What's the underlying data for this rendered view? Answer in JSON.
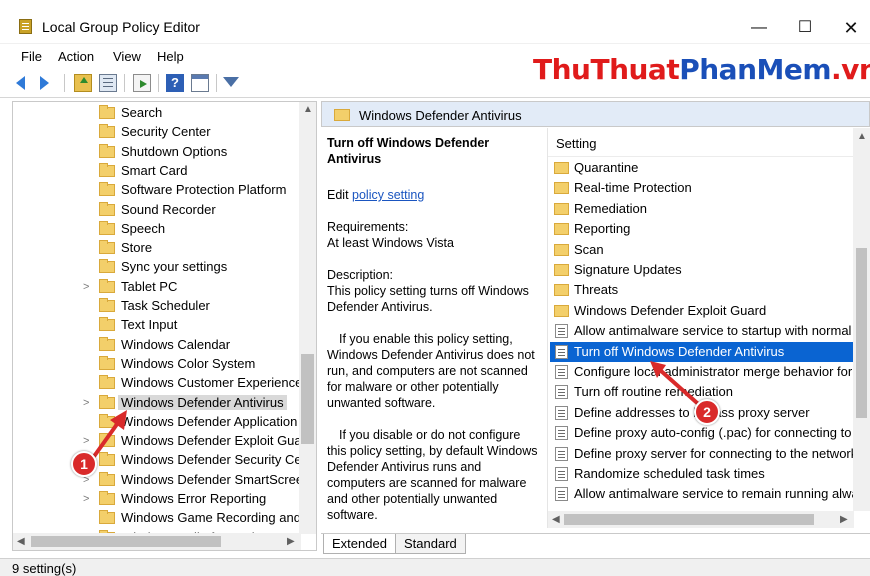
{
  "window": {
    "title": "Local Group Policy Editor",
    "minimize_glyph": "—",
    "maximize_glyph": "☐",
    "close_glyph": "✕"
  },
  "menu": [
    "File",
    "Action",
    "View",
    "Help"
  ],
  "toolbar": {
    "icons": [
      "back-icon",
      "forward-icon",
      "up-folder-icon",
      "show-hide-tree-icon",
      "export-list-icon",
      "help-icon",
      "properties-icon",
      "filter-icon"
    ],
    "help_glyph": "?"
  },
  "watermark": {
    "part1": "ThuThuat",
    "part2": "PhanMem",
    "part3": ".vn",
    "color1": "#e01b1b",
    "color2": "#1a4fb8"
  },
  "tree": {
    "items": [
      {
        "label": "Search",
        "expandable": false
      },
      {
        "label": "Security Center",
        "expandable": false
      },
      {
        "label": "Shutdown Options",
        "expandable": false
      },
      {
        "label": "Smart Card",
        "expandable": false
      },
      {
        "label": "Software Protection Platform",
        "expandable": false
      },
      {
        "label": "Sound Recorder",
        "expandable": false
      },
      {
        "label": "Speech",
        "expandable": false
      },
      {
        "label": "Store",
        "expandable": false
      },
      {
        "label": "Sync your settings",
        "expandable": false
      },
      {
        "label": "Tablet PC",
        "expandable": true
      },
      {
        "label": "Task Scheduler",
        "expandable": false
      },
      {
        "label": "Text Input",
        "expandable": false
      },
      {
        "label": "Windows Calendar",
        "expandable": false
      },
      {
        "label": "Windows Color System",
        "expandable": false
      },
      {
        "label": "Windows Customer Experience",
        "expandable": false
      },
      {
        "label": "Windows Defender Antivirus",
        "expandable": true,
        "selected": true
      },
      {
        "label": "Windows Defender Application",
        "expandable": false
      },
      {
        "label": "Windows Defender Exploit Guar",
        "expandable": true
      },
      {
        "label": "Windows Defender Security Cer",
        "expandable": true
      },
      {
        "label": "Windows Defender SmartScreer",
        "expandable": true
      },
      {
        "label": "Windows Error Reporting",
        "expandable": true
      },
      {
        "label": "Windows Game Recording and",
        "expandable": false
      },
      {
        "label": "Windows Hello for Business",
        "expandable": false
      }
    ],
    "chevron_glyph": ">"
  },
  "right_pane": {
    "header": "Windows Defender Antivirus",
    "description": {
      "title": "Turn off Windows Defender Antivirus",
      "edit_prefix": "Edit ",
      "edit_link": "policy setting ",
      "requirements_label": "Requirements:",
      "requirements_value": "At least Windows Vista",
      "description_label": "Description:",
      "description_text": "This policy setting turns off Windows Defender Antivirus.",
      "enable_text": "If you enable this policy setting, Windows Defender Antivirus does not run, and computers are not scanned for malware or other potentially unwanted software.",
      "disable_text": "If you disable or do not configure this policy setting, by default Windows Defender Antivirus runs and computers are scanned for malware and other potentially unwanted software."
    },
    "list": {
      "column_header": "Setting",
      "items": [
        {
          "type": "folder",
          "label": "Quarantine"
        },
        {
          "type": "folder",
          "label": "Real-time Protection"
        },
        {
          "type": "folder",
          "label": "Remediation"
        },
        {
          "type": "folder",
          "label": "Reporting"
        },
        {
          "type": "folder",
          "label": "Scan"
        },
        {
          "type": "folder",
          "label": "Signature Updates"
        },
        {
          "type": "folder",
          "label": "Threats"
        },
        {
          "type": "folder",
          "label": "Windows Defender Exploit Guard"
        },
        {
          "type": "policy",
          "label": "Allow antimalware service to startup with normal p"
        },
        {
          "type": "policy",
          "label": "Turn off Windows Defender Antivirus",
          "selected": true
        },
        {
          "type": "policy",
          "label": "Configure local administrator merge behavior for li"
        },
        {
          "type": "policy",
          "label": "Turn off routine remediation"
        },
        {
          "type": "policy",
          "label": "Define addresses to bypass proxy server"
        },
        {
          "type": "policy",
          "label": "Define proxy auto-config (.pac) for connecting to t"
        },
        {
          "type": "policy",
          "label": "Define proxy server for connecting to the network"
        },
        {
          "type": "policy",
          "label": "Randomize scheduled task times"
        },
        {
          "type": "policy",
          "label": "Allow antimalware service to remain running alway"
        }
      ]
    },
    "tabs": [
      {
        "label": "Extended",
        "active": true
      },
      {
        "label": "Standard",
        "active": false
      }
    ]
  },
  "status_bar": {
    "text": "9 setting(s)"
  },
  "annotations": [
    {
      "label": "1"
    },
    {
      "label": "2"
    }
  ],
  "colors": {
    "selection": "#0a64d2",
    "badge": "#d92a2a",
    "header_bg": "#e2ebf7"
  }
}
